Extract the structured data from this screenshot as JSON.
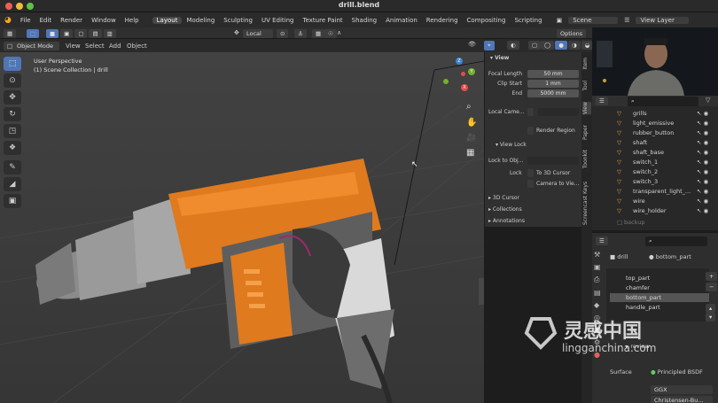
{
  "window": {
    "title": "drill.blend"
  },
  "menu": [
    "File",
    "Edit",
    "Render",
    "Window",
    "Help"
  ],
  "workspaces": [
    "Layout",
    "Modeling",
    "Sculpting",
    "UV Editing",
    "Texture Paint",
    "Shading",
    "Animation",
    "Rendering",
    "Compositing",
    "Scripting"
  ],
  "scene": "Scene",
  "view_layer": "View Layer",
  "header": {
    "transform_space": "Local",
    "options": "Options"
  },
  "mode": {
    "label": "Object Mode",
    "menus": [
      "View",
      "Select",
      "Add",
      "Object"
    ]
  },
  "viewport": {
    "perspective": "User Perspective",
    "collection": "(1) Scene Collection | drill"
  },
  "gizmo": {
    "x": "X",
    "y": "Y",
    "z": "Z"
  },
  "npanel": {
    "view_header": "View",
    "focal_length_label": "Focal Length",
    "focal_length": "50 mm",
    "clip_start_label": "Clip Start",
    "clip_start": "1 mm",
    "clip_end_label": "End",
    "clip_end": "5000 mm",
    "local_camera_label": "Local Came...",
    "render_region": "Render Region",
    "view_lock_header": "View Lock",
    "lock_to_object_label": "Lock to Obj...",
    "lock_label": "Lock",
    "to_3d_cursor": "To 3D Cursor",
    "camera_to_view": "Camera to Vie...",
    "cursor_header": "3D Cursor",
    "collections_header": "Collections",
    "annotations_header": "Annotations"
  },
  "side_tabs": [
    "Item",
    "Tool",
    "View",
    "Paper",
    "Toonkit",
    "Screencast Keys"
  ],
  "outliner": {
    "items": [
      "grills",
      "light_emissive",
      "rubber_button",
      "shaft",
      "shaft_base",
      "switch_1",
      "switch_2",
      "switch_3",
      "transparent_light_...",
      "wire",
      "wire_holder",
      "backup"
    ]
  },
  "properties": {
    "object_name": "drill",
    "material_name": "bottom_part",
    "slots": [
      "top_part",
      "chamfer",
      "bottom_part",
      "handle_part"
    ],
    "selected_slot": "bottom_part",
    "preview_label": "review",
    "surface_label": "Surface",
    "surface_value": "Principled BSDF",
    "distribution": "GGX",
    "subsurface_method": "Christensen-Bu..."
  },
  "watermark": {
    "main": "灵感中国",
    "sub": "lingganchina.com"
  },
  "colors": {
    "accent": "#5076b8",
    "orange": "#e07a1e",
    "axis_x": "#e44a4a",
    "axis_y": "#74b02b",
    "axis_z": "#3c83d6"
  }
}
